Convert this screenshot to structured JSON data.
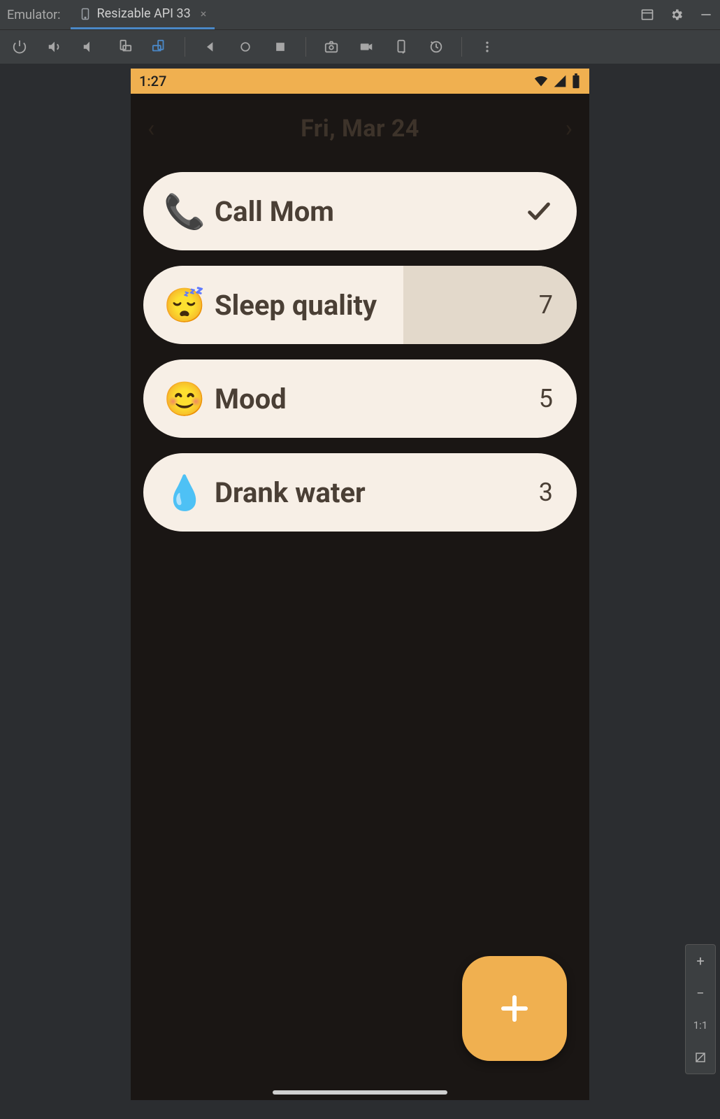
{
  "ide": {
    "title": "Emulator:",
    "tab_label": "Resizable API 33",
    "zoom_label": "1:1"
  },
  "device": {
    "clock": "1:27",
    "date": "Fri, Mar 24"
  },
  "cards": [
    {
      "emoji": "📞",
      "label": "Call Mom",
      "kind": "check",
      "value": "✓"
    },
    {
      "emoji": "😴",
      "label": "Sleep quality",
      "kind": "slider",
      "value": "7",
      "fill_pct": 60
    },
    {
      "emoji": "😊",
      "label": "Mood",
      "kind": "value",
      "value": "5"
    },
    {
      "emoji": "💧",
      "label": "Drank water",
      "kind": "value",
      "value": "3"
    }
  ],
  "colors": {
    "accent": "#f0b050",
    "card_bg": "#f7efe6",
    "card_tint": "#e3d9cb",
    "app_bg": "#1a1614",
    "ide_bg": "#3c3f41"
  }
}
